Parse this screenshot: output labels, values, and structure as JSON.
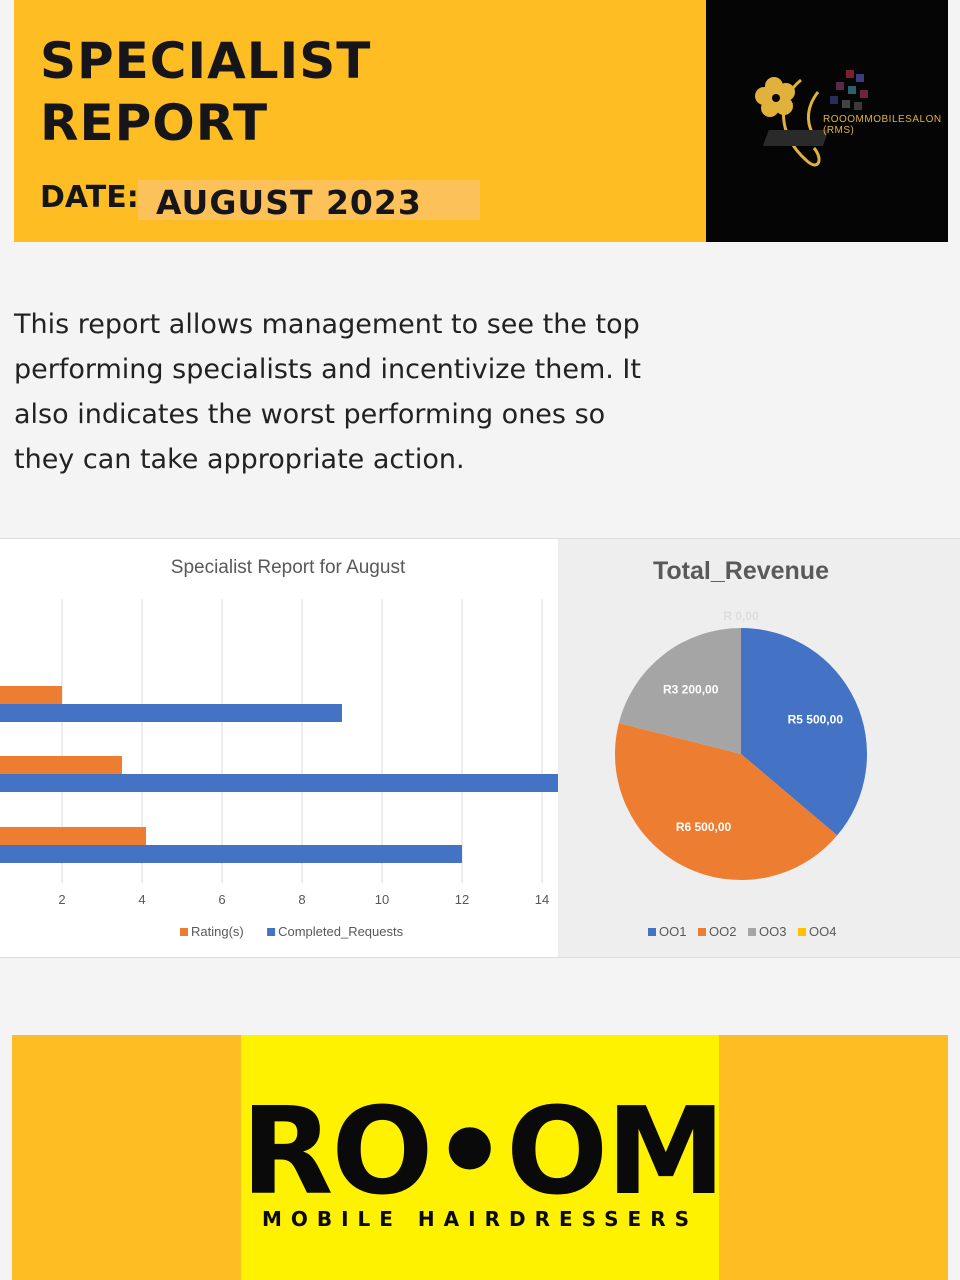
{
  "header": {
    "title": "SPECIALIST\nREPORT",
    "date_label": "DATE:",
    "date_value": "AUGUST  2023",
    "logo_text": "ROOOMMOBILESALON\n(RMS)"
  },
  "intro": "This report allows management to see the top performing specialists and incentivize them. It also indicates the worst performing ones so they can take appropriate action.",
  "colors": {
    "brand_yellow": "#fdbd23",
    "blue": "#4472c4",
    "orange": "#ed7d31",
    "gray": "#a5a5a5",
    "gold": "#ffc000"
  },
  "chart_data": [
    {
      "type": "bar",
      "orientation": "horizontal",
      "title": "Specialist Report for August",
      "x_ticks": [
        2,
        4,
        6,
        8,
        10,
        12,
        14
      ],
      "xlim": [
        0,
        14.4
      ],
      "grid": true,
      "legend_position": "bottom",
      "series": [
        {
          "name": "Rating(s)",
          "color": "#ed7d31",
          "values": [
            2,
            3.5,
            4.1
          ]
        },
        {
          "name": "Completed_Requests",
          "color": "#4472c4",
          "values": [
            9,
            14.4,
            12
          ]
        }
      ]
    },
    {
      "type": "pie",
      "title": "Total_Revenue",
      "legend_position": "bottom",
      "slices": [
        {
          "name": "OO1",
          "value": 5500,
          "label": "R5 500,00",
          "color": "#4472c4"
        },
        {
          "name": "OO2",
          "value": 6500,
          "label": "R6 500,00",
          "color": "#ed7d31"
        },
        {
          "name": "OO3",
          "value": 3200,
          "label": "R3 200,00",
          "color": "#a5a5a5"
        },
        {
          "name": "OO4",
          "value": 0,
          "label": "R 0,00",
          "color": "#ffc000"
        }
      ]
    }
  ],
  "footer": {
    "brand": "RO•OM",
    "tagline": "MOBILE HAIRDRESSERS"
  }
}
